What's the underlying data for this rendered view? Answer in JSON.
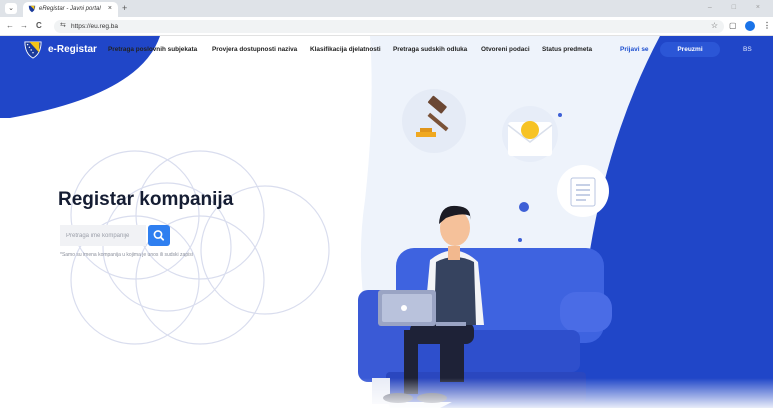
{
  "browser": {
    "tab_title": "eRegistar - Javni portal",
    "tab_close": "×",
    "new_tab": "+",
    "window_controls": "– □ ×",
    "url": "https://eu.reg.ba",
    "back": "←",
    "forward": "→",
    "reload": "C",
    "site_info": "⇆",
    "bookmark_star": "☆",
    "extensions": "▢",
    "menu": "⋮"
  },
  "site": {
    "logo": "e-Registar",
    "nav": [
      "Pretraga poslovnih subjekata",
      "Provjera dostupnosti naziva",
      "Klasifikacija djelatnosti",
      "Pretraga sudskih odluka",
      "Otvoreni podaci",
      "Status predmeta"
    ],
    "login": "Prijavi se",
    "download": "Preuzmi",
    "language": "BS",
    "colors": {
      "brand_blue": "#2046c8",
      "accent_blue": "#2f7ff0",
      "navy": "#1b2a6b"
    }
  },
  "hero": {
    "title": "Registar kompanija",
    "search_placeholder": "Pretraga ime kompanije",
    "search_icon": "search-icon",
    "hint": "*Samo su imena kompanija u kojima je unos ili sudski zapisi"
  }
}
